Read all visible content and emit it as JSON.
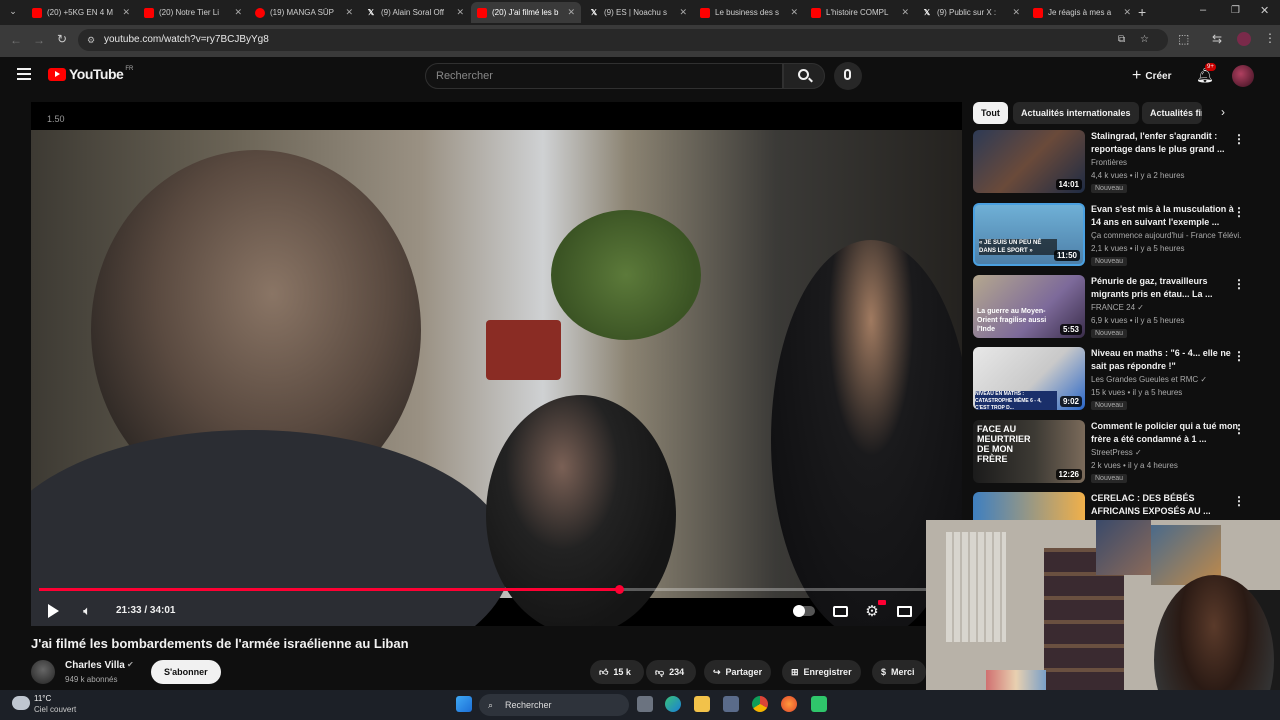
{
  "browser": {
    "tabs": [
      {
        "title": "(20) +5KG EN 4 M",
        "icon": "youtube"
      },
      {
        "title": "(20) Notre Tier Li",
        "icon": "youtube"
      },
      {
        "title": "(19) MANGA SŪP",
        "icon": "youtube-circle"
      },
      {
        "title": "(9) Alain Soral Off",
        "icon": "x"
      },
      {
        "title": "(20) J'ai filmé les b",
        "icon": "youtube",
        "active": true
      },
      {
        "title": "(9) ES | Noachu s",
        "icon": "x"
      },
      {
        "title": "Le business des s",
        "icon": "youtube"
      },
      {
        "title": "L'histoire COMPL",
        "icon": "youtube"
      },
      {
        "title": "(9) Public sur X : ",
        "icon": "x"
      },
      {
        "title": "Je réagis à mes a",
        "icon": "youtube"
      }
    ],
    "url": "youtube.com/watch?v=ry7BCJByYg8"
  },
  "header": {
    "logo_text": "YouTube",
    "logo_region": "FR",
    "search_placeholder": "Rechercher",
    "create_label": "Créer",
    "notif_count": "9+"
  },
  "video": {
    "overlay_text": "1.50",
    "time": "21:33 / 34:01",
    "progress": 0.634,
    "title": "J'ai filmé les bombardements de l'armée israélienne au Liban",
    "channel": "Charles Villa",
    "subscribers": "949 k abonnés",
    "subscribe_label": "S'abonner",
    "likes": "15 k",
    "dislikes": "234",
    "share_label": "Partager",
    "save_label": "Enregistrer",
    "thanks_label": "Merci"
  },
  "chips": [
    "Tout",
    "Actualités internationales",
    "Actualités fin"
  ],
  "recommendations": [
    {
      "title": "Stalingrad, l'enfer s'agrandit : reportage dans le plus grand ...",
      "channel": "Frontières",
      "meta": "4,4 k vues  •  il y a 2 heures",
      "duration": "14:01",
      "badge": "Nouveau"
    },
    {
      "title": "Evan s'est mis à la musculation à 14 ans en suivant l'exemple ...",
      "channel": "Ça commence aujourd'hui - France Télévi...",
      "meta": "2,1 k vues  •  il y a 5 heures",
      "duration": "11:50",
      "badge": "Nouveau",
      "thumb_text": "« JE SUIS UN PEU NÉ DANS LE SPORT »"
    },
    {
      "title": "Pénurie de gaz, travailleurs migrants pris en étau... La ...",
      "channel": "FRANCE 24 ✓",
      "meta": "6,9 k vues  •  il y a 5 heures",
      "duration": "5:53",
      "badge": "Nouveau",
      "thumb_text": "La guerre au Moyen-Orient fragilise aussi l'Inde"
    },
    {
      "title": "Niveau en maths : \"6 - 4... elle ne sait pas répondre !\"",
      "channel": "Les Grandes Gueules et RMC ✓",
      "meta": "15 k vues  •  il y a 5 heures",
      "duration": "9:02",
      "badge": "Nouveau",
      "thumb_text": "NIVEAU EN MATHS : CATASTROPHE MÊME 6 - 4, C'EST TROP D..."
    },
    {
      "title": "Comment le policier qui a tué mon frère a été condamné à 1 ...",
      "channel": "StreetPress ✓",
      "meta": "2 k vues  •  il y a 4 heures",
      "duration": "12:26",
      "badge": "Nouveau",
      "thumb_text": "FACE AU MEURTRIER DE MON FRÈRE"
    },
    {
      "title": "CERELAC : DES BÉBÉS AFRICAINS EXPOSÉS AU ...",
      "channel": "",
      "meta": "",
      "duration": "",
      "badge": ""
    }
  ],
  "taskbar": {
    "weather_temp": "11°C",
    "weather_desc": "Ciel couvert",
    "search_label": "Rechercher"
  },
  "colors": {
    "accent_red": "#ff0033",
    "bg": "#0f0f0f"
  }
}
